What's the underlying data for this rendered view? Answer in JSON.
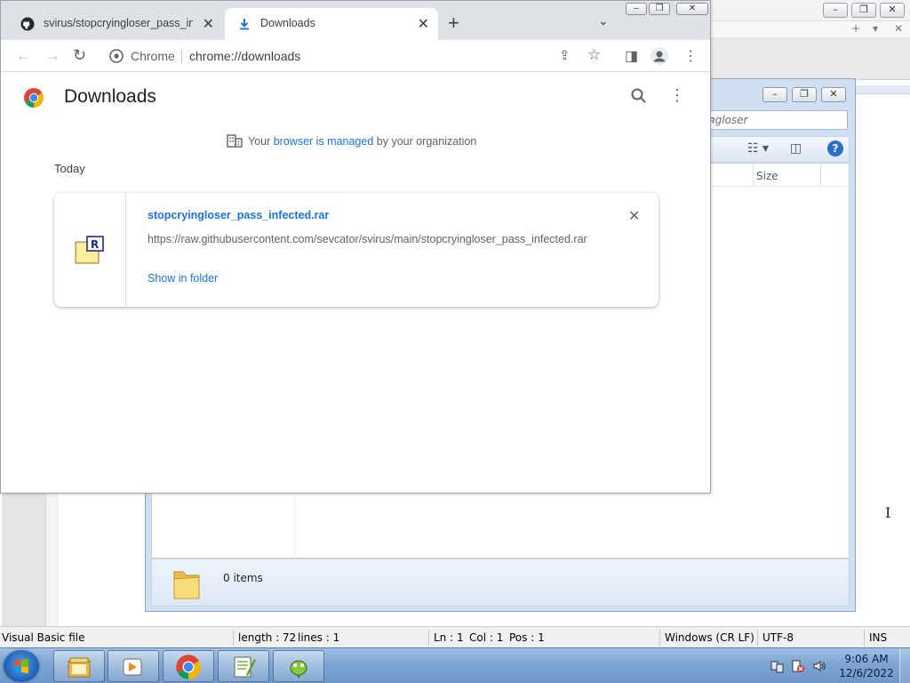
{
  "chrome": {
    "tabs": [
      {
        "label": "svirus/stopcryingloser_pass_infected",
        "icon": "github-icon",
        "active": false
      },
      {
        "label": "Downloads",
        "icon": "download-icon",
        "active": true
      }
    ],
    "omnibox": {
      "chip": "Chrome",
      "url": "chrome://downloads"
    },
    "page": {
      "title": "Downloads",
      "managed_prefix": "Your ",
      "managed_link": "browser is managed",
      "managed_suffix": " by your organization",
      "section": "Today",
      "items": [
        {
          "filename": "stopcryingloser_pass_infected.rar",
          "url": "https://raw.githubusercontent.com/sevcator/svirus/main/stopcryingloser_pass_infected.rar",
          "action": "Show in folder",
          "icon": "rar-archive-icon"
        }
      ]
    }
  },
  "explorer": {
    "search_placeholder": "ngloser",
    "column_size": "Size",
    "item_count": "0 items"
  },
  "notepadpp": {
    "status": {
      "filetype": "Visual Basic file",
      "length": "length : 72",
      "lines": "lines : 1",
      "ln": "Ln : 1",
      "col": "Col : 1",
      "pos": "Pos : 1",
      "eol": "Windows (CR LF)",
      "encoding": "UTF-8",
      "mode": "INS"
    }
  },
  "taskbar": {
    "time": "9:06 AM",
    "date": "12/6/2022",
    "pinned": [
      "windows-explorer",
      "media-player",
      "google-chrome",
      "notepad-plus-plus",
      "bug-tool"
    ]
  },
  "colors": {
    "accent": "#1a73e8",
    "taskbar": "#7ea5d3",
    "tab_strip": "#dee1e6"
  }
}
